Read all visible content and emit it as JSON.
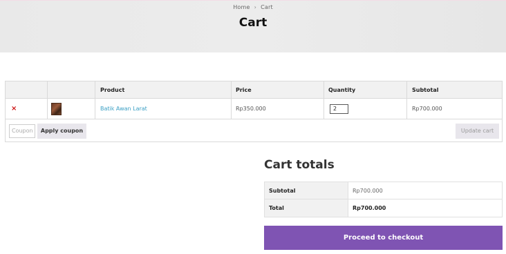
{
  "breadcrumb": {
    "home": "Home",
    "separator": "›",
    "current": "Cart"
  },
  "page_title": "Cart",
  "cart_table": {
    "headers": [
      "",
      "",
      "Product",
      "Price",
      "Quantity",
      "Subtotal"
    ],
    "rows": [
      {
        "remove_symbol": "×",
        "thumbnail": "product-image",
        "product": "Batik Awan Larat",
        "price": "Rp350.000",
        "quantity": "2",
        "subtotal": "Rp700.000"
      }
    ],
    "coupon_placeholder": "Coupon",
    "apply_coupon_label": "Apply coupon",
    "update_cart_label": "Update cart"
  },
  "totals": {
    "title": "Cart totals",
    "subtotal_label": "Subtotal",
    "subtotal_value": "Rp700.000",
    "total_label": "Total",
    "total_value": "Rp700.000"
  },
  "checkout_label": "Proceed to checkout",
  "colors": {
    "accent": "#7f54b3",
    "link": "#3a9fc4",
    "remove": "#cc1111"
  }
}
